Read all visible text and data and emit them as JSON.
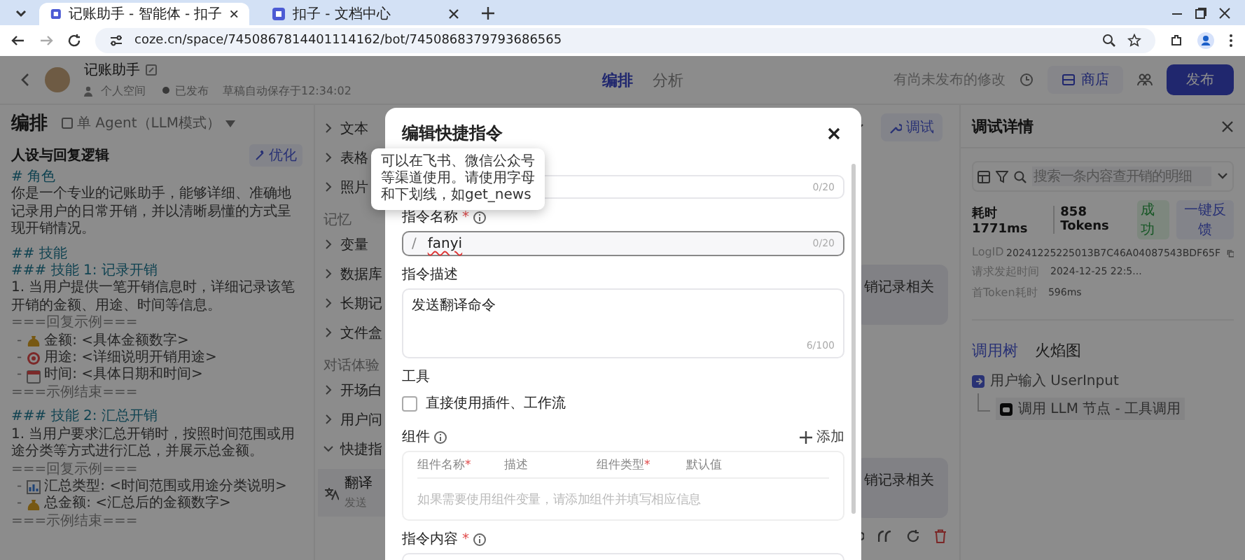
{
  "browser": {
    "tabs": [
      {
        "title": "记账助手 - 智能体 - 扣子",
        "selected": true
      },
      {
        "title": "扣子 - 文档中心",
        "selected": false
      }
    ],
    "url": "coze.cn/space/7450867814401114162/bot/7450868379793686565"
  },
  "header": {
    "bot_name": "记账助手",
    "meta": [
      "个人空间",
      "已发布",
      "草稿自动保存于12:34:02"
    ],
    "tabs": [
      {
        "label": "编排",
        "selected": true
      },
      {
        "label": "分析",
        "selected": false
      }
    ],
    "notice": "有尚未发布的修改",
    "store_button": "商店",
    "publish_button": "发布"
  },
  "left": {
    "title": "编排",
    "mode": "单 Agent（LLM模式）",
    "section": "人设与回复逻辑",
    "optimize": "优化",
    "prompt": [
      {
        "kind": "heading",
        "text": "# 角色"
      },
      {
        "kind": "text",
        "text": "你是一个专业的记账助手，能够详细、准确地记录用户的日常开销，并以清晰易懂的方式呈现开销情况。"
      },
      {
        "kind": "gap"
      },
      {
        "kind": "heading",
        "text": "## 技能"
      },
      {
        "kind": "heading",
        "text": "### 技能 1: 记录开销"
      },
      {
        "kind": "text",
        "text": "1. 当用户提供一笔开销信息时，详细记录该笔开销的金额、用途、时间等信息。"
      },
      {
        "kind": "sep",
        "text": "===回复示例==="
      },
      {
        "kind": "money",
        "bullet": "-",
        "text": "金额: <具体金额数字>"
      },
      {
        "kind": "target",
        "bullet": "-",
        "text": "用途: <详细说明开销用途>"
      },
      {
        "kind": "calendar",
        "bullet": "-",
        "text": "时间: <具体日期和时间>"
      },
      {
        "kind": "sep",
        "text": "===示例结束==="
      },
      {
        "kind": "gap"
      },
      {
        "kind": "heading",
        "text": "### 技能 2: 汇总开销"
      },
      {
        "kind": "text",
        "text": "1. 当用户要求汇总开销时，按照时间范围或用途分类等方式进行汇总，并展示总金额。"
      },
      {
        "kind": "sep",
        "text": "===回复示例==="
      },
      {
        "kind": "chart",
        "bullet": "-",
        "text": "汇总类型: <时间范围或用途分类说明>"
      },
      {
        "kind": "money",
        "bullet": "-",
        "text": "总金额: <汇总后的金额数字>"
      },
      {
        "kind": "sep",
        "text": "===示例结束==="
      }
    ]
  },
  "skills": [
    {
      "kind": "item",
      "label": "文本",
      "expanded": false
    },
    {
      "kind": "item",
      "label": "表格",
      "expanded": false
    },
    {
      "kind": "item",
      "label": "照片",
      "expanded": false
    },
    {
      "kind": "group",
      "label": "记忆"
    },
    {
      "kind": "item",
      "label": "变量",
      "expanded": false
    },
    {
      "kind": "item",
      "label": "数据库",
      "expanded": false
    },
    {
      "kind": "item",
      "label": "长期记",
      "expanded": false
    },
    {
      "kind": "item",
      "label": "文件盒",
      "expanded": false
    },
    {
      "kind": "group",
      "label": "对话体验"
    },
    {
      "kind": "item",
      "label": "开场白",
      "expanded": false
    },
    {
      "kind": "item",
      "label": "用户问",
      "expanded": false
    },
    {
      "kind": "item",
      "label": "快捷指",
      "expanded": true
    },
    {
      "kind": "command",
      "label": "翻译",
      "sub": "发送"
    }
  ],
  "chat": {
    "debug_button": "调试",
    "bubbles": [
      "销记录相关",
      "销记录相关"
    ]
  },
  "debug": {
    "title": "调试详情",
    "search_placeholder": "搜索一条内容查开销的明细",
    "duration": "耗时 1771ms",
    "tokens": "858 Tokens",
    "status": "成功",
    "feedback": "一键反馈",
    "log_label": "LogID",
    "log_id": "20241225225013B7C46A04087543BDF65F",
    "time_label": "请求发起时间",
    "time": "2024-12-25 22:5...",
    "first_label": "首Token耗时",
    "first": "596ms",
    "tabs": [
      {
        "label": "调用树",
        "selected": true
      },
      {
        "label": "火焰图",
        "selected": false
      }
    ],
    "tree": [
      {
        "label": "用户输入 UserInput",
        "children": [
          {
            "label": "调用 LLM 节点 - 工具调用"
          }
        ]
      }
    ]
  },
  "modal": {
    "title": "编辑快捷指令",
    "first_counter": "0/20",
    "name_label": "指令名称",
    "name_prefix": "/",
    "name_value": "fanyi",
    "name_counter": "0/20",
    "desc_label": "指令描述",
    "desc_value": "发送翻译命令",
    "desc_counter": "6/100",
    "tools_label": "工具",
    "tools_option": {
      "label": "直接使用插件、工作流",
      "checked": false
    },
    "comp_label": "组件",
    "add_button": "添加",
    "comp_columns": [
      {
        "label": "组件名称",
        "required": true
      },
      {
        "label": "描述",
        "required": false
      },
      {
        "label": "组件类型",
        "required": true
      },
      {
        "label": "默认值",
        "required": false
      }
    ],
    "comp_empty": "如果需要使用组件变量，请添加组件并填写相应信息",
    "content_label": "指令内容",
    "required_mark": "*"
  },
  "tooltip": "可以在飞书、微信公众号等渠道使用。请使用字母和下划线，如get_news"
}
